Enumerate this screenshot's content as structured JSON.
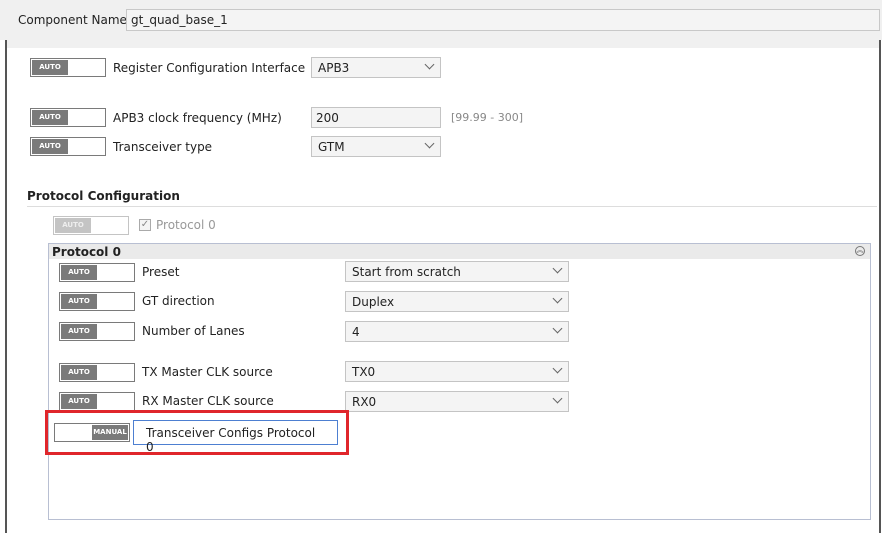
{
  "header": {
    "component_name_label": "Component Name",
    "component_name_value": "gt_quad_base_1"
  },
  "toggle": {
    "auto": "AUTO",
    "manual": "MANUAL"
  },
  "params": {
    "reg_config": {
      "label": "Register Configuration Interface",
      "value": "APB3"
    },
    "apb3_clock": {
      "label": "APB3 clock frequency (MHz)",
      "value": "200",
      "range": "[99.99 - 300]"
    },
    "transceiver_type": {
      "label": "Transceiver type",
      "value": "GTM"
    }
  },
  "protocol_config": {
    "title": "Protocol Configuration",
    "protocol0_checkbox_label": "Protocol 0",
    "protocol0_checked": true
  },
  "protocol0": {
    "title": "Protocol 0",
    "rows": [
      {
        "label": "Preset",
        "value": "Start from scratch"
      },
      {
        "label": "GT direction",
        "value": "Duplex"
      },
      {
        "label": "Number of Lanes",
        "value": "4"
      },
      {
        "label": "TX Master CLK source",
        "value": "TX0"
      },
      {
        "label": "RX Master CLK source",
        "value": "RX0"
      }
    ],
    "transceiver_configs_button": "Transceiver Configs Protocol 0"
  },
  "icons": {
    "chevron": "chevron-down-icon",
    "collapse": "collapse-up-icon",
    "check": "checkmark-icon"
  },
  "colors": {
    "highlight": "#e0262b",
    "toggle_auto": "#7a7a7a",
    "button_border": "#4d7fd1"
  }
}
